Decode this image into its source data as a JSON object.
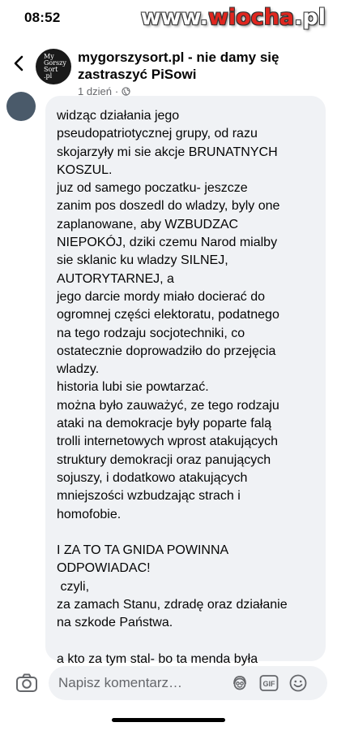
{
  "status_bar": {
    "time": "08:52"
  },
  "watermark": {
    "prefix": "www.",
    "accent": "wiocha",
    "suffix": ".pl"
  },
  "post": {
    "logo_lines": [
      "My",
      "Gorszy",
      "Sort",
      ".pl"
    ],
    "title": "mygorszysort.pl - nie damy się zastraszyć PiSowi",
    "meta_time": "1 dzień",
    "meta_separator": "·"
  },
  "comment": {
    "text": "widząc działania jego\npseudopatriotycznej grupy, od razu\nskojarzyły mi sie akcje BRUNATNYCH\nKOSZUL.\njuz od samego poczatku- jeszcze\nzanim pos doszedl do wladzy, byly one\nzaplanowane, aby WZBUDZAC\nNIEPOKÓJ, dziki czemu Narod mialby\nsie sklanic ku wladzy SILNEJ,\nAUTORYTARNEJ, a\njego darcie mordy miało docierać do\nogromnej części elektoratu, podatnego\nna tego rodzaju socjotechniki, co\nostatecznie doprowadziło do przejęcia\nwladzy.\nhistoria lubi sie powtarzać.\nmożna było zauważyć, ze tego rodzaju\nataki na demokracje były poparte falą\ntrolli internetowych wprost atakujących\nstruktury demokracji oraz panujących\nsojuszy, i dodatkowo atakujących\nmniejszości wzbudzając strach i\nhomofobie.\n\nI ZA TO TA GNIDA POWINNA\nODPOWIADAC!\n czyli,\nza zamach Stanu, zdradę oraz działanie\nna szkode Państwa.\n\na kto za tym stal- bo ta menda była\ntylko pionkiem- to chyba jasne!"
  },
  "composer": {
    "placeholder": "Napisz komentarz…",
    "gif_label": "GIF"
  },
  "icons": {
    "back": "chevron-left-icon",
    "camera": "camera-icon",
    "avatar": "avatar-sticker-icon",
    "gif": "gif-icon",
    "smile": "emoji-icon",
    "globe": "globe-icon"
  },
  "colors": {
    "bubble": "#f0f2f5",
    "meta_gray": "#65676b",
    "watermark_accent": "#e0261f"
  }
}
